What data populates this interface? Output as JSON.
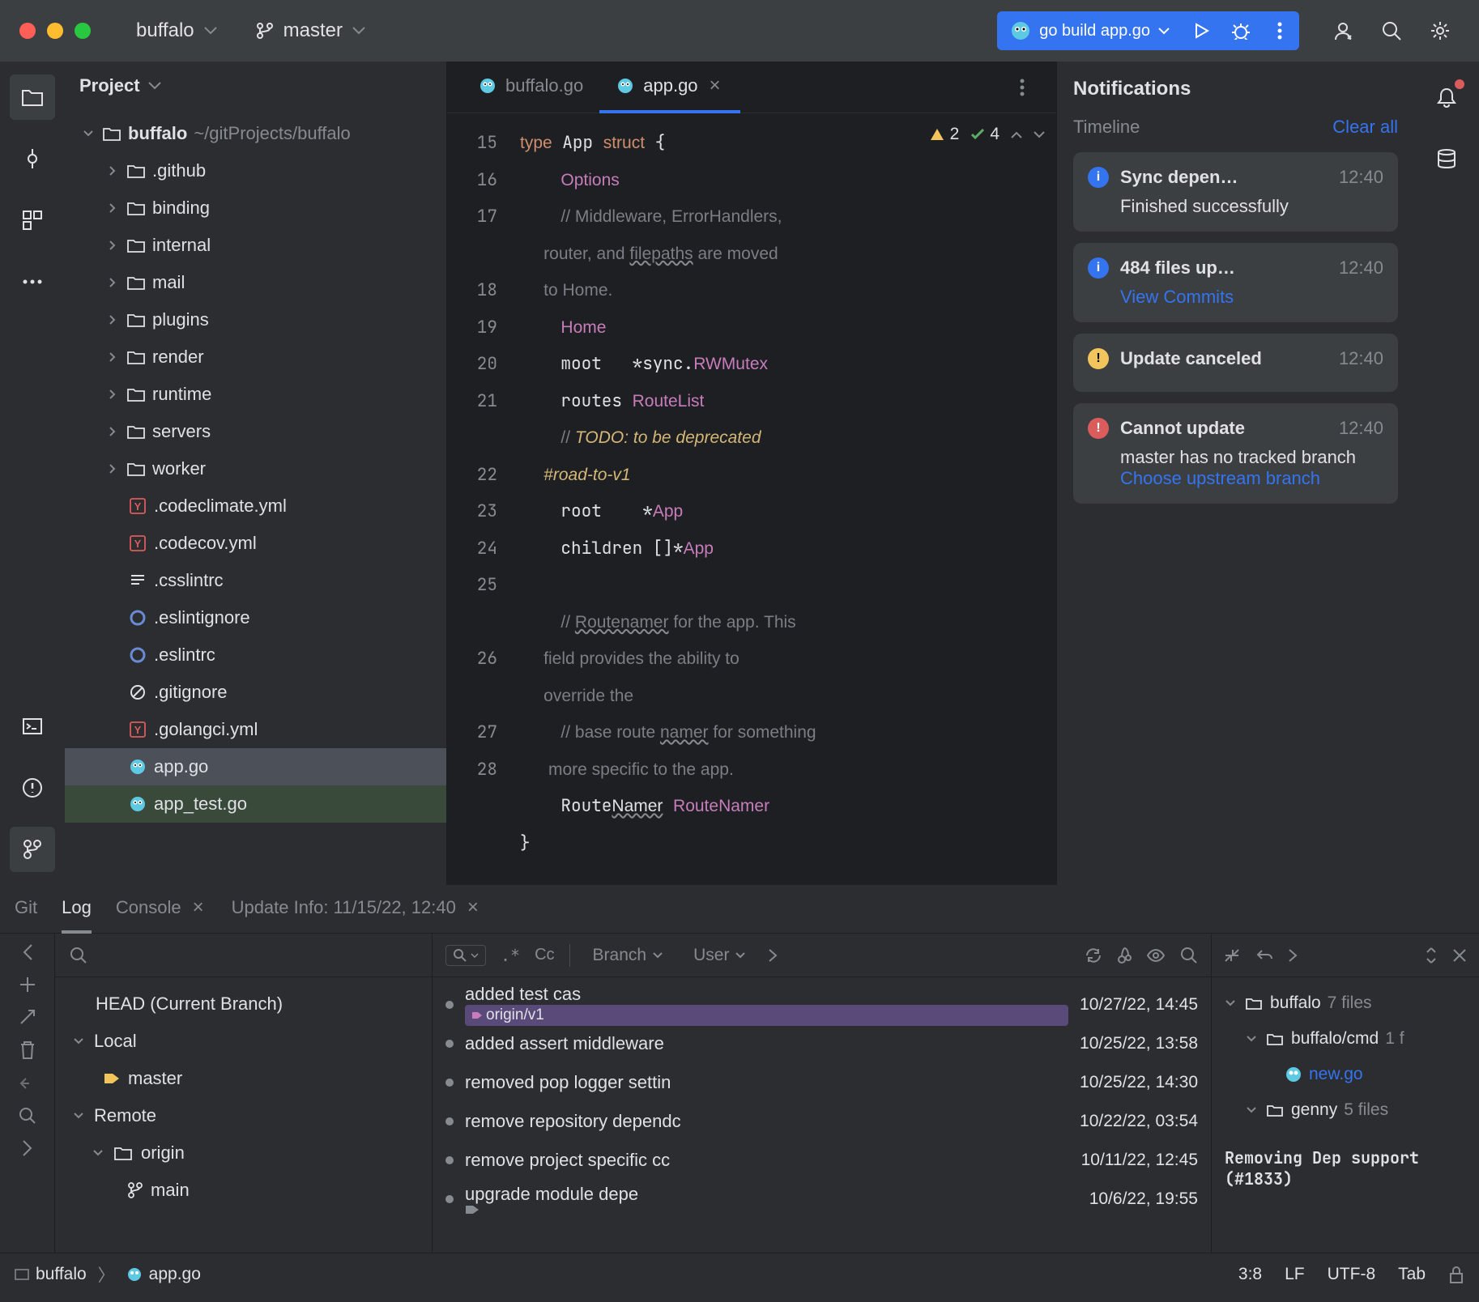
{
  "top": {
    "project": "buffalo",
    "branch": "master",
    "runConfig": "go build app.go"
  },
  "sidebar": {
    "title": "Project"
  },
  "tree": {
    "root": {
      "name": "buffalo",
      "path": "~/gitProjects/buffalo"
    },
    "folders": [
      ".github",
      "binding",
      "internal",
      "mail",
      "plugins",
      "render",
      "runtime",
      "servers",
      "worker"
    ],
    "files": [
      {
        "name": ".codeclimate.yml",
        "icon": "y"
      },
      {
        "name": ".codecov.yml",
        "icon": "y"
      },
      {
        "name": ".csslintrc",
        "icon": "lines"
      },
      {
        "name": ".eslintignore",
        "icon": "ring"
      },
      {
        "name": ".eslintrc",
        "icon": "ring"
      },
      {
        "name": ".gitignore",
        "icon": "no"
      },
      {
        "name": ".golangci.yml",
        "icon": "y"
      },
      {
        "name": "app.go",
        "icon": "go",
        "sel": true
      },
      {
        "name": "app_test.go",
        "icon": "go",
        "test": true
      }
    ]
  },
  "tabs": [
    {
      "name": "buffalo.go",
      "icon": "go"
    },
    {
      "name": "app.go",
      "icon": "go",
      "act": true,
      "close": true
    }
  ],
  "indicators": {
    "warn": "2",
    "ok": "4"
  },
  "code": {
    "lines": [
      "15",
      "16",
      "17",
      "",
      "18",
      "19",
      "20",
      "21",
      "",
      "22",
      "23",
      "24",
      "25",
      "",
      "26",
      "",
      "27",
      "28"
    ]
  },
  "notifications": {
    "title": "Notifications",
    "timeline": "Timeline",
    "clear": "Clear all",
    "items": [
      {
        "type": "i",
        "title": "Sync depen…",
        "time": "12:40",
        "msg": "Finished successfully"
      },
      {
        "type": "i",
        "title": "484 files up…",
        "time": "12:40",
        "link": "View Commits"
      },
      {
        "type": "w",
        "title": "Update canceled",
        "time": "12:40"
      },
      {
        "type": "e",
        "title": "Cannot update",
        "time": "12:40",
        "msg": "master has no tracked branch",
        "link": "Choose upstream branch"
      }
    ]
  },
  "bottomTabs": [
    "Git",
    "Log",
    "Console",
    "Update Info: 11/15/22, 12:40"
  ],
  "branches": {
    "head": "HEAD (Current Branch)",
    "local": "Local",
    "master": "master",
    "remote": "Remote",
    "origin": "origin",
    "main": "main"
  },
  "filters": {
    "regex": ".*",
    "case": "Cc",
    "branch": "Branch",
    "user": "User"
  },
  "commits": [
    {
      "msg": "added test cas",
      "tag": "origin/v1",
      "date": "10/27/22, 14:45"
    },
    {
      "msg": "added assert middleware",
      "date": "10/25/22, 13:58"
    },
    {
      "msg": "removed pop logger settin",
      "date": "10/25/22, 14:30"
    },
    {
      "msg": "remove repository dependc",
      "date": "10/22/22, 03:54"
    },
    {
      "msg": "remove project specific cc",
      "date": "10/11/22, 12:45"
    },
    {
      "msg": "upgrade module depe",
      "tag2": true,
      "date": "10/6/22, 19:55"
    }
  ],
  "changedFiles": {
    "root": {
      "name": "buffalo",
      "count": "7 files"
    },
    "cmd": {
      "name": "buffalo/cmd",
      "count": "1 f"
    },
    "file": "new.go",
    "genny": {
      "name": "genny",
      "count": "5 files"
    }
  },
  "commitMsg": "Removing Dep support (#1833)",
  "status": {
    "bc1": "buffalo",
    "bc2": "app.go",
    "pos": "3:8",
    "le": "LF",
    "enc": "UTF-8",
    "ind": "Tab"
  }
}
